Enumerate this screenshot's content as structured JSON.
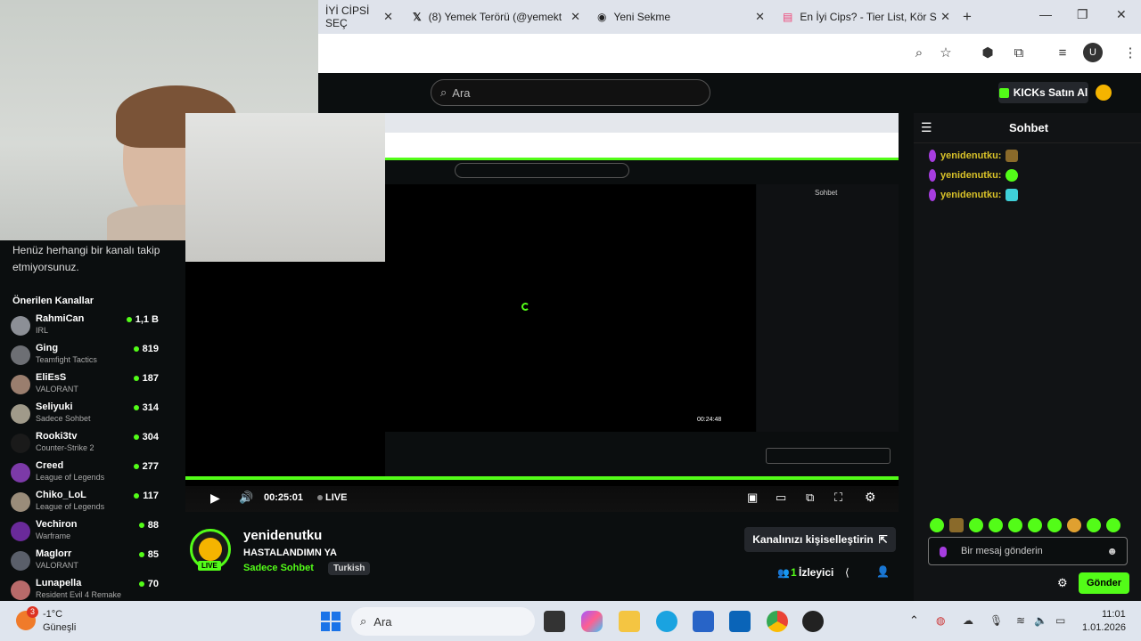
{
  "browser": {
    "tabs": [
      {
        "label": "İYİ CİPSİ SEÇ"
      },
      {
        "label": "(8) Yemek Terörü (@yemekt"
      },
      {
        "label": "Yeni Sekme"
      },
      {
        "label": "En İyi Cips? - Tier List, Kör S"
      }
    ],
    "profile_initial": "U"
  },
  "header": {
    "search_placeholder": "Ara",
    "kicks_button": "KICKs Satın Al"
  },
  "sidebar": {
    "no_follow_message": "Henüz herhangi bir kanalı takip etmiyorsunuz.",
    "recommended_title": "Önerilen Kanallar",
    "channels": [
      {
        "name": "RahmiCan",
        "category": "IRL",
        "viewers": "1,1 B"
      },
      {
        "name": "Ging",
        "category": "Teamfight Tactics",
        "viewers": "819"
      },
      {
        "name": "EliEsS",
        "category": "VALORANT",
        "viewers": "187"
      },
      {
        "name": "Seliyuki",
        "category": "Sadece Sohbet",
        "viewers": "314"
      },
      {
        "name": "Rooki3tv",
        "category": "Counter-Strike 2",
        "viewers": "304"
      },
      {
        "name": "Creed",
        "category": "League of Legends",
        "viewers": "277"
      },
      {
        "name": "Chiko_LoL",
        "category": "League of Legends",
        "viewers": "117"
      },
      {
        "name": "Vechiron",
        "category": "Warframe",
        "viewers": "88"
      },
      {
        "name": "Maglorr",
        "category": "VALORANT",
        "viewers": "85"
      },
      {
        "name": "Lunapella",
        "category": "Resident Evil 4 Remake",
        "viewers": "70"
      }
    ]
  },
  "player": {
    "time": "00:25:01",
    "live_label": "LIVE",
    "inner_time": "00:24:48"
  },
  "stream": {
    "channel": "yenidenutku",
    "title": "HASTALANDIMN YA",
    "category": "Sadece Sohbet",
    "language": "Turkish",
    "viewer_count": "1",
    "viewer_label": "İzleyici",
    "customize_button": "Kanalınızı kişiselleştirin",
    "live_badge": "LIVE"
  },
  "chat": {
    "title": "Sohbet",
    "messages": [
      {
        "user": "yenidenutku:"
      },
      {
        "user": "yenidenutku:"
      },
      {
        "user": "yenidenutku:"
      }
    ],
    "input_placeholder": "Bir mesaj gönderin",
    "send_button": "Gönder"
  },
  "taskbar": {
    "weather_temp": "-1°C",
    "weather_desc": "Güneşli",
    "search": "Ara",
    "time": "11:01",
    "date": "1.01.2026",
    "weather_badge": "3"
  },
  "colors": {
    "accent": "#53fc18",
    "chat_user": "#d9c229"
  }
}
